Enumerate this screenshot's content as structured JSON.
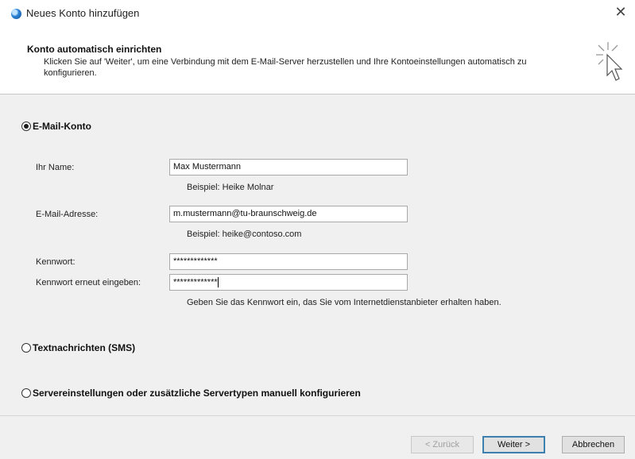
{
  "window": {
    "title": "Neues Konto hinzufügen",
    "close_glyph": "✕"
  },
  "header": {
    "title": "Konto automatisch einrichten",
    "description": "Klicken Sie auf 'Weiter', um eine Verbindung mit dem E-Mail-Server herzustellen und Ihre Kontoeinstellungen automatisch zu konfigurieren.",
    "icon": "wizard-cursor-icon"
  },
  "options": {
    "email_account": {
      "label": "E-Mail-Konto",
      "selected": true
    },
    "sms": {
      "label": "Textnachrichten (SMS)",
      "selected": false
    },
    "manual": {
      "label": "Servereinstellungen oder zusätzliche Servertypen manuell konfigurieren",
      "selected": false
    }
  },
  "form": {
    "name_label": "Ihr Name:",
    "name_value": "Max Mustermann",
    "name_hint": "Beispiel: Heike Molnar",
    "email_label": "E-Mail-Adresse:",
    "email_value": "m.mustermann@tu-braunschweig.de",
    "email_hint": "Beispiel: heike@contoso.com",
    "password_label": "Kennwort:",
    "password_value": "*************",
    "password_repeat_label": "Kennwort erneut eingeben:",
    "password_repeat_value": "*************",
    "password_hint": "Geben Sie das Kennwort ein, das Sie vom Internetdienstanbieter erhalten haben."
  },
  "buttons": {
    "back": "< Zurück",
    "next": "Weiter >",
    "cancel": "Abbrechen"
  }
}
